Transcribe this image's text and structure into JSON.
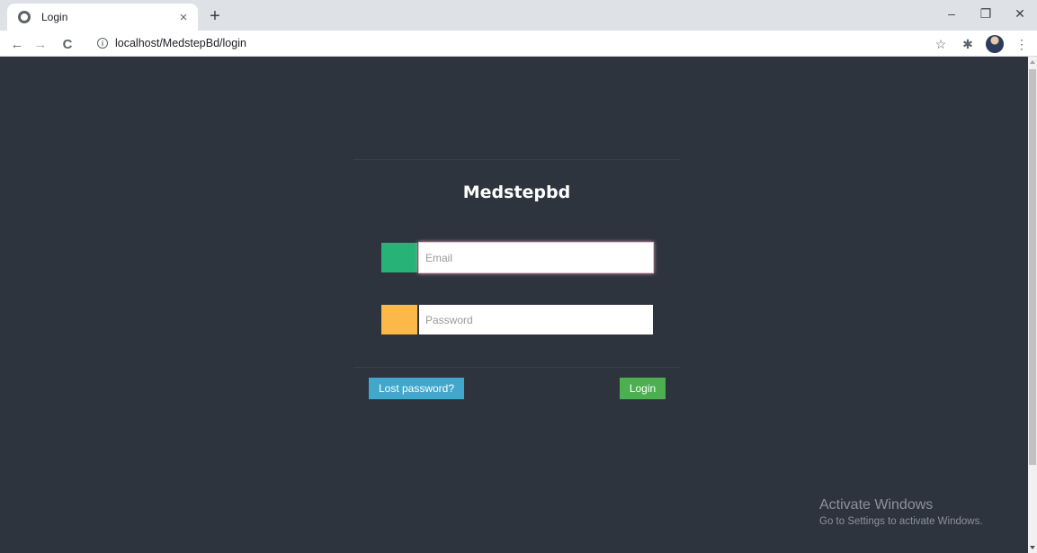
{
  "browser": {
    "tab": {
      "title": "Login",
      "icon": "globe-icon",
      "close": "×"
    },
    "new_tab": "+",
    "window_controls": {
      "minimize": "–",
      "restore": "❐",
      "close": "✕"
    },
    "nav": {
      "back": "←",
      "forward": "→",
      "reload": "C"
    },
    "address": {
      "info_icon": "i",
      "url": "localhost/MedstepBd/login"
    },
    "toolbar_icons": {
      "bookmark": "☆",
      "extensions": "✱",
      "menu": "⋮"
    }
  },
  "page": {
    "brand": "Medstepbd",
    "email": {
      "placeholder": "Email",
      "value": ""
    },
    "password": {
      "placeholder": "Password",
      "value": ""
    },
    "lost_password_button": "Lost password?",
    "login_button": "Login",
    "colors": {
      "background": "#2e343e",
      "email_addon": "#27b377",
      "password_addon": "#fdb84a",
      "lost_password": "#41a7cc",
      "login": "#4caf50"
    }
  },
  "watermark": {
    "title": "Activate Windows",
    "subtitle": "Go to Settings to activate Windows."
  }
}
